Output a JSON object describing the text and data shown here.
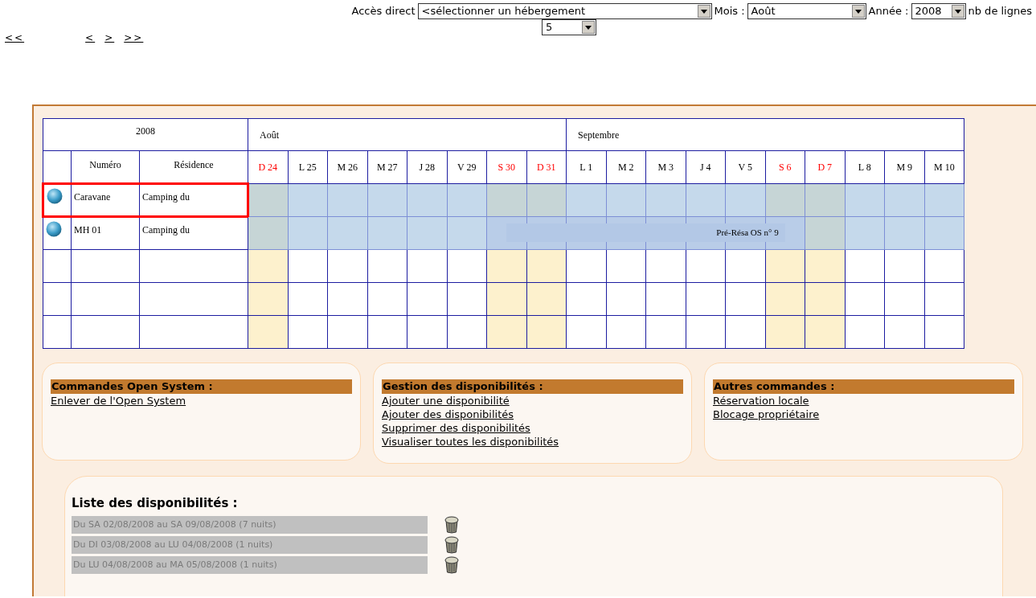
{
  "nav": [
    "<<",
    "<",
    ">",
    ">>"
  ],
  "filters": [
    {
      "label": "Accès direct",
      "value": "<sélectionner un hébergement"
    },
    {
      "label": "Mois :",
      "value": "Août"
    },
    {
      "label": "Année :",
      "value": "2008"
    },
    {
      "label": "nb de lignes",
      "value": "5"
    }
  ],
  "planning": {
    "year": "2008",
    "months": [
      {
        "name": "Août",
        "days": [
          {
            "label": "D 24",
            "weekend": true
          },
          {
            "label": "L 25",
            "weekend": false
          },
          {
            "label": "M 26",
            "weekend": false
          },
          {
            "label": "M 27",
            "weekend": false
          },
          {
            "label": "J 28",
            "weekend": false
          },
          {
            "label": "V 29",
            "weekend": false
          },
          {
            "label": "S 30",
            "weekend": true
          },
          {
            "label": "D 31",
            "weekend": true
          }
        ]
      },
      {
        "name": "Septembre",
        "days": [
          {
            "label": "L 1",
            "weekend": false
          },
          {
            "label": "M 2",
            "weekend": false
          },
          {
            "label": "M 3",
            "weekend": false
          },
          {
            "label": "J 4",
            "weekend": false
          },
          {
            "label": "V 5",
            "weekend": false
          },
          {
            "label": "S 6",
            "weekend": true
          },
          {
            "label": "D 7",
            "weekend": true
          },
          {
            "label": "L 8",
            "weekend": false
          },
          {
            "label": "M 9",
            "weekend": false
          },
          {
            "label": "M 10",
            "weekend": false
          }
        ]
      }
    ],
    "columns": [
      "Numéro",
      "Résidence"
    ],
    "rows": [
      {
        "kind": "accommodation",
        "numero": "Caravane",
        "residence": "Camping du",
        "selected": true,
        "booked": [
          false,
          false,
          false,
          false,
          false,
          false,
          false,
          false,
          false,
          false,
          false,
          false,
          false,
          false,
          false,
          false,
          false,
          false
        ]
      },
      {
        "kind": "accommodation",
        "numero": "MH 01",
        "residence": "Camping du",
        "selected": false,
        "booked": [
          false,
          false,
          false,
          false,
          false,
          false,
          true,
          true,
          true,
          true,
          true,
          true,
          true,
          true,
          false,
          false,
          false,
          false
        ],
        "booking_label": "Pré-Résa OS n° 9"
      },
      {
        "kind": "empty"
      },
      {
        "kind": "empty"
      },
      {
        "kind": "empty"
      }
    ]
  },
  "command_boxes": [
    {
      "title": "Commandes Open System :",
      "links": [
        "Enlever de l'Open System"
      ]
    },
    {
      "title": "Gestion des disponibilités :",
      "links": [
        "Ajouter une disponibilité",
        "Ajouter des disponibilités",
        "Supprimer des disponibilités",
        "Visualiser toutes les disponibilités"
      ]
    },
    {
      "title": "Autres commandes :",
      "links": [
        "Réservation locale",
        "Blocage propriétaire"
      ]
    }
  ],
  "availability_list": {
    "title": "Liste des disponibilités :",
    "items": [
      "Du SA 02/08/2008 au SA 09/08/2008 (7 nuits)",
      "Du DI 03/08/2008 au LU 04/08/2008 (1 nuits)",
      "Du LU 04/08/2008 au MA 05/08/2008 (1 nuits)"
    ]
  }
}
